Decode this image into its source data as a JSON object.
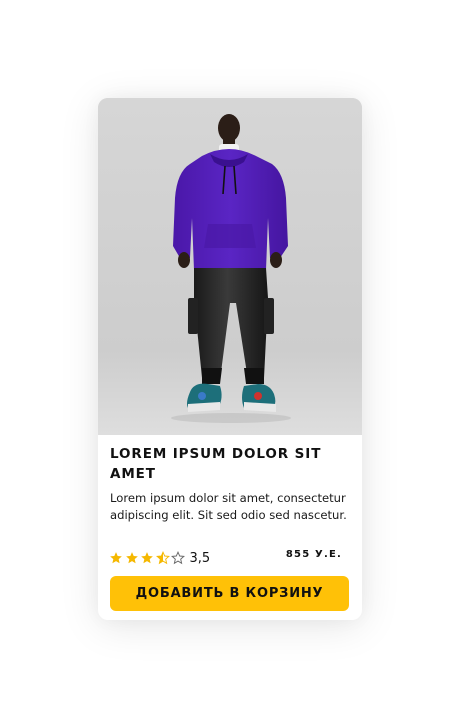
{
  "product": {
    "title": "LOREM IPSUM DOLOR SIT AMET",
    "description": "Lorem ipsum dolor sit amet, consectetur adipiscing elit. Sit sed odio sed nascetur.",
    "rating": 3.5,
    "rating_text": "3,5",
    "rating_max": 5,
    "price": "855 У.Е.",
    "add_to_cart_label": "ДОБАВИТЬ В КОРЗИНУ",
    "image_icon": "product-photo-hoodie-model"
  },
  "colors": {
    "accent": "#ffc107",
    "star": "#f5b800",
    "text": "#111111"
  }
}
